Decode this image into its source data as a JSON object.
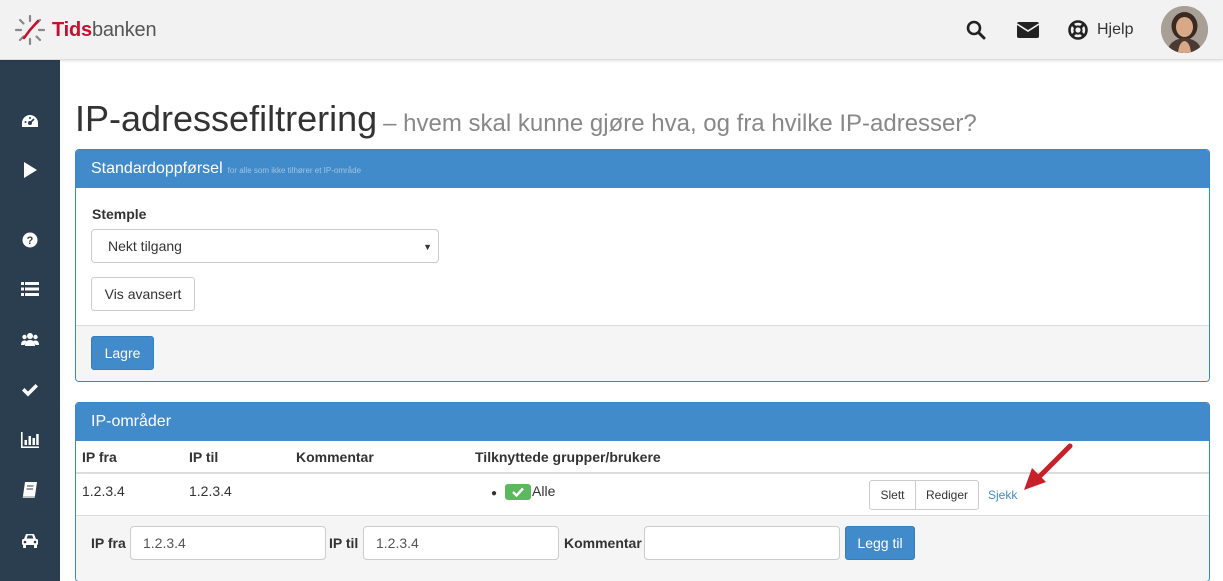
{
  "app": {
    "logo_bold": "Tids",
    "logo_rest": "banken",
    "help_label": "Hjelp"
  },
  "colors": {
    "brand_red": "#c8102e",
    "sidebar_bg": "#2b3e50",
    "primary": "#428bca",
    "success": "#5cb85c",
    "annotation_arrow": "#c8202a"
  },
  "sidebar": {
    "items": [
      {
        "icon": "dashboard-icon"
      },
      {
        "icon": "play-icon"
      },
      {
        "icon": "question-circle-icon"
      },
      {
        "icon": "list-icon"
      },
      {
        "icon": "users-icon"
      },
      {
        "icon": "check-icon"
      },
      {
        "icon": "bar-chart-icon"
      },
      {
        "icon": "book-icon"
      },
      {
        "icon": "car-icon"
      }
    ]
  },
  "page": {
    "title": "IP-adressefiltrering",
    "subtitle": "– hvem skal kunne gjøre hva, og fra hvilke IP-adresser?"
  },
  "standard_panel": {
    "heading": "Standardoppførsel",
    "heading_small": "for alle som ikke tilhører et IP-område",
    "field_label": "Stemple",
    "select_value": "Nekt tilgang",
    "advanced_button": "Vis avansert",
    "save_button": "Lagre"
  },
  "ip_panel": {
    "heading": "IP-områder",
    "columns": [
      "IP fra",
      "IP til",
      "Kommentar",
      "Tilknyttede grupper/brukere"
    ],
    "rows": [
      {
        "ip_from": "1.2.3.4",
        "ip_to": "1.2.3.4",
        "comment": "",
        "groups": [
          "Alle"
        ],
        "actions": {
          "delete": "Slett",
          "edit": "Rediger",
          "check": "Sjekk"
        }
      }
    ],
    "add_form": {
      "ip_from_label": "IP fra",
      "ip_from_value": "1.2.3.4",
      "ip_to_label": "IP til",
      "ip_to_value": "1.2.3.4",
      "comment_label": "Kommentar",
      "comment_value": "",
      "add_button": "Legg til"
    }
  }
}
